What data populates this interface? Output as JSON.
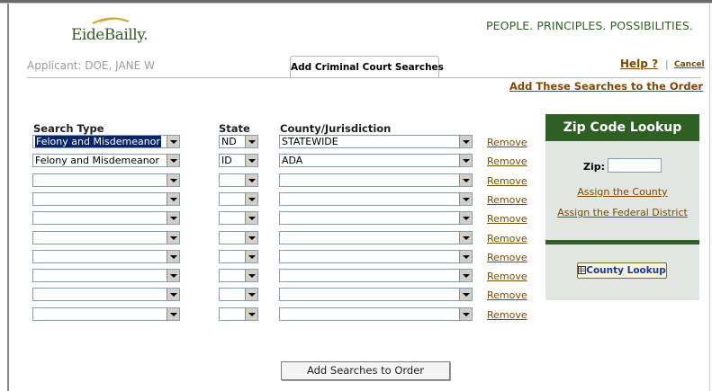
{
  "header": {
    "logo_text": "EideBailly.",
    "tagline": "PEOPLE. PRINCIPLES. POSSIBILITIES.",
    "applicant": "Applicant: DOE, JANE W",
    "tab_label": "Add Criminal Court Searches",
    "help_label": "Help ?",
    "separator": "|",
    "cancel_label": "Cancel",
    "add_order_link": "Add These Searches to the Order"
  },
  "columns": {
    "search_type": "Search Type",
    "state": "State",
    "county": "County/Jurisdiction"
  },
  "rows": [
    {
      "search_type": "Felony and Misdemeanor",
      "state": "ND",
      "county": "STATEWIDE",
      "remove": "Remove",
      "highlighted": true
    },
    {
      "search_type": "Felony and Misdemeanor",
      "state": "ID",
      "county": "ADA",
      "remove": "Remove",
      "highlighted": false
    },
    {
      "search_type": "",
      "state": "",
      "county": "",
      "remove": "Remove",
      "highlighted": false
    },
    {
      "search_type": "",
      "state": "",
      "county": "",
      "remove": "Remove",
      "highlighted": false
    },
    {
      "search_type": "",
      "state": "",
      "county": "",
      "remove": "Remove",
      "highlighted": false
    },
    {
      "search_type": "",
      "state": "",
      "county": "",
      "remove": "Remove",
      "highlighted": false
    },
    {
      "search_type": "",
      "state": "",
      "county": "",
      "remove": "Remove",
      "highlighted": false
    },
    {
      "search_type": "",
      "state": "",
      "county": "",
      "remove": "Remove",
      "highlighted": false
    },
    {
      "search_type": "",
      "state": "",
      "county": "",
      "remove": "Remove",
      "highlighted": false
    },
    {
      "search_type": "",
      "state": "",
      "county": "",
      "remove": "Remove",
      "highlighted": false
    }
  ],
  "zip_lookup": {
    "title": "Zip Code Lookup",
    "zip_label": "Zip:",
    "zip_value": "",
    "assign_county": "Assign the County",
    "assign_federal": "Assign the Federal District",
    "county_lookup_button": "County Lookup"
  },
  "footer": {
    "submit_label": "Add Searches to Order"
  },
  "colors": {
    "brand_green": "#2f5f22",
    "link_brown": "#7a4a00",
    "panel_bg": "#e2e6e3",
    "selection_blue": "#0a246a"
  }
}
